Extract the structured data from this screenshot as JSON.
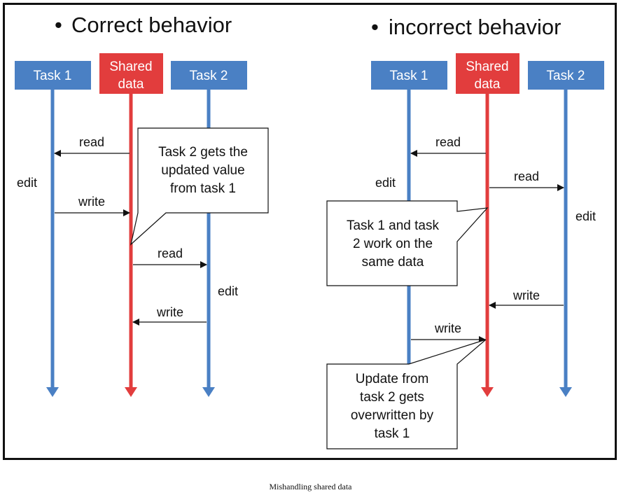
{
  "colors": {
    "task": "#4a80c4",
    "shared": "#e23d3d",
    "ink": "#111111",
    "box_text": "#ffffff"
  },
  "correct": {
    "title": "Correct behavior",
    "task1": "Task 1",
    "shared": [
      "Shared",
      "data"
    ],
    "task2": "Task 2",
    "read1": "read",
    "edit1": "edit",
    "write1": "write",
    "read2": "read",
    "edit2": "edit",
    "write2": "write",
    "note": [
      "Task 2 gets the",
      "updated value",
      "from task 1"
    ]
  },
  "incorrect": {
    "title": "incorrect behavior",
    "task1": "Task 1",
    "shared": [
      "Shared",
      "data"
    ],
    "task2": "Task 2",
    "read1": "read",
    "edit1": "edit",
    "read2": "read",
    "edit2": "edit",
    "write2": "write",
    "write1": "write",
    "note1": [
      "Task 1 and task",
      "2 work on the",
      "same data"
    ],
    "note2": [
      "Update from",
      "task 2 gets",
      "overwritten by",
      "task 1"
    ]
  },
  "caption": "Mishandling shared data"
}
